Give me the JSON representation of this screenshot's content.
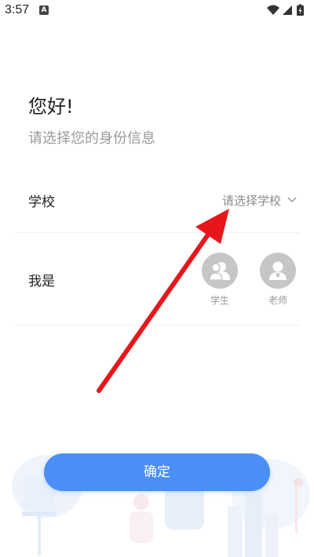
{
  "status_bar": {
    "time": "3:57",
    "notification_icon": "a-icon",
    "icons": [
      "wifi-icon",
      "signal-icon",
      "battery-charging-icon"
    ]
  },
  "header": {
    "greeting": "您好!",
    "subtitle": "请选择您的身份信息"
  },
  "school": {
    "label": "学校",
    "placeholder": "请选择学校",
    "icon": "chevron-down-icon"
  },
  "identity": {
    "label": "我是",
    "roles": [
      {
        "label": "学生",
        "icon": "student-icon"
      },
      {
        "label": "老师",
        "icon": "teacher-icon"
      }
    ]
  },
  "confirm_button": {
    "label": "确定"
  },
  "colors": {
    "accent": "#4a8ff5",
    "annotation_arrow": "#e8161b",
    "role_inactive": "#c6c6c6"
  }
}
